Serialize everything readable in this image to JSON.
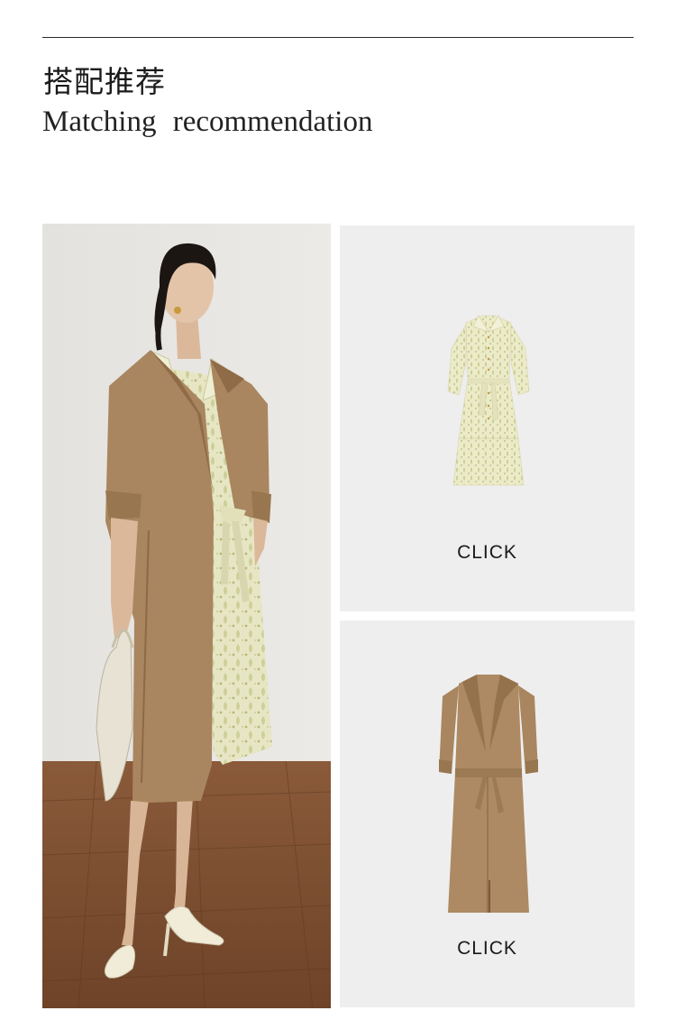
{
  "header": {
    "title_cn": "搭配推荐",
    "title_en": "Matching recommendation"
  },
  "model_photo": {
    "description_icon": "model-outfit-photo"
  },
  "products": [
    {
      "item_icon": "floral-shirt-dress-icon",
      "action_label": "CLICK"
    },
    {
      "item_icon": "khaki-trench-coat-icon",
      "action_label": "CLICK"
    }
  ],
  "colors": {
    "card_background": "#eeeeee",
    "khaki": "#a9865f",
    "floral_base": "#ecebc9"
  }
}
